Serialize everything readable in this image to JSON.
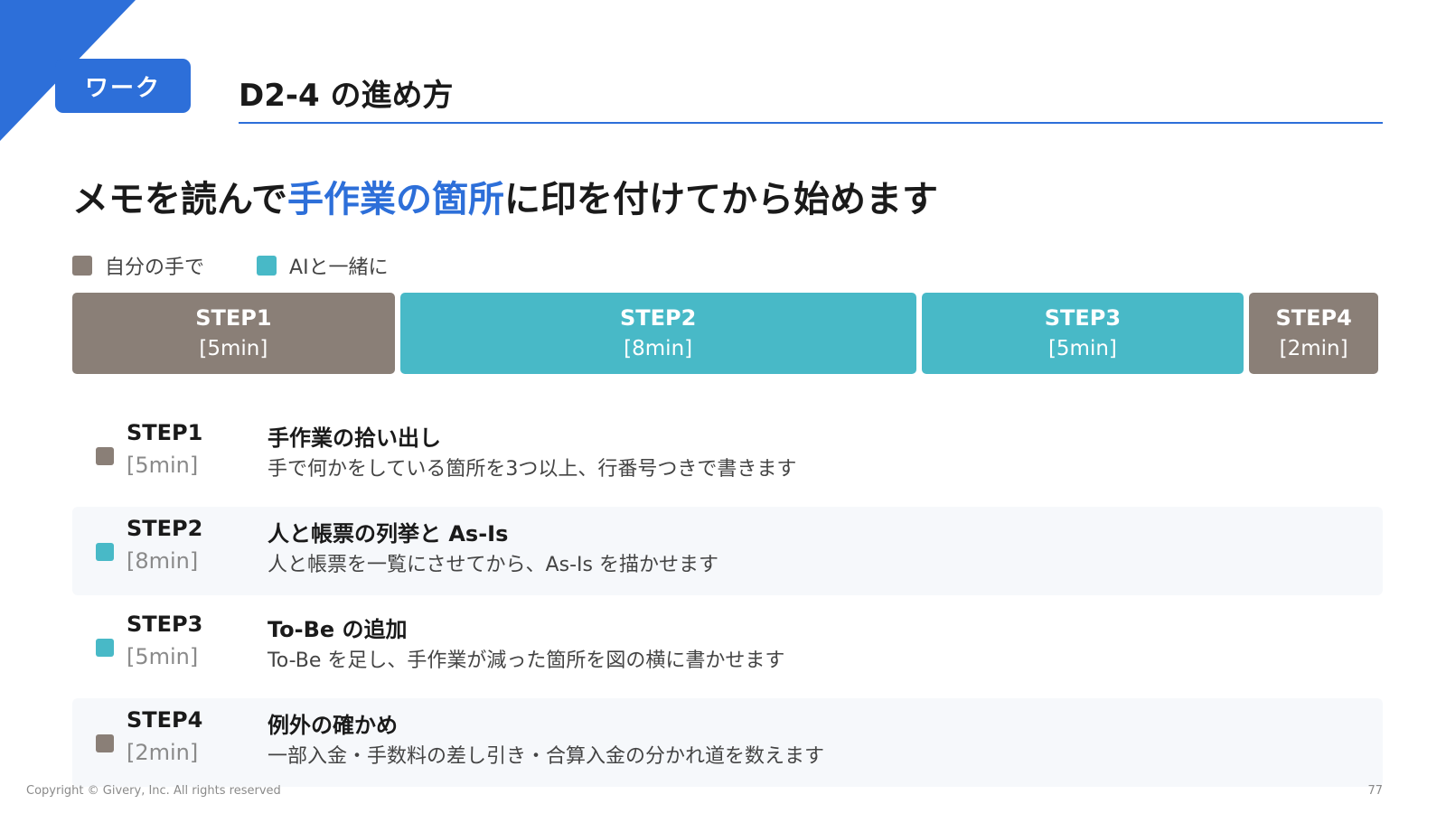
{
  "badge": "ワーク",
  "page_title": "D2-4 の進め方",
  "headline": {
    "part1": "メモを読んで",
    "highlight": "手作業の箇所",
    "part2": "に印を付けてから始めます"
  },
  "legend": [
    {
      "label": "自分の手で",
      "color": "#8a7f77"
    },
    {
      "label": "AIと一緒に",
      "color": "#48b9c7"
    }
  ],
  "timeline": [
    {
      "name": "STEP1",
      "duration": "[5min]",
      "minutes": 5,
      "color": "#8a7f77"
    },
    {
      "name": "STEP2",
      "duration": "[8min]",
      "minutes": 8,
      "color": "#48b9c7"
    },
    {
      "name": "STEP3",
      "duration": "[5min]",
      "minutes": 5,
      "color": "#48b9c7"
    },
    {
      "name": "STEP4",
      "duration": "[2min]",
      "minutes": 2,
      "color": "#8a7f77"
    }
  ],
  "steps": [
    {
      "step": "STEP1",
      "duration": "[5min]",
      "title": "手作業の拾い出し",
      "description": "手で何かをしている箇所を3つ以上、行番号つきで書きます",
      "color": "#8a7f77"
    },
    {
      "step": "STEP2",
      "duration": "[8min]",
      "title": "人と帳票の列挙と As-Is",
      "description": "人と帳票を一覧にさせてから、As-Is を描かせます",
      "color": "#48b9c7"
    },
    {
      "step": "STEP3",
      "duration": "[5min]",
      "title": "To-Be の追加",
      "description": "To-Be を足し、手作業が減った箇所を図の横に書かせます",
      "color": "#48b9c7"
    },
    {
      "step": "STEP4",
      "duration": "[2min]",
      "title": "例外の確かめ",
      "description": "一部入金・手数料の差し引き・合算入金の分かれ道を数えます",
      "color": "#8a7f77"
    }
  ],
  "footer": {
    "copyright": "Copyright © Givery, Inc. All rights reserved",
    "page_number": "77"
  },
  "accent_color": "#2d6fd9"
}
